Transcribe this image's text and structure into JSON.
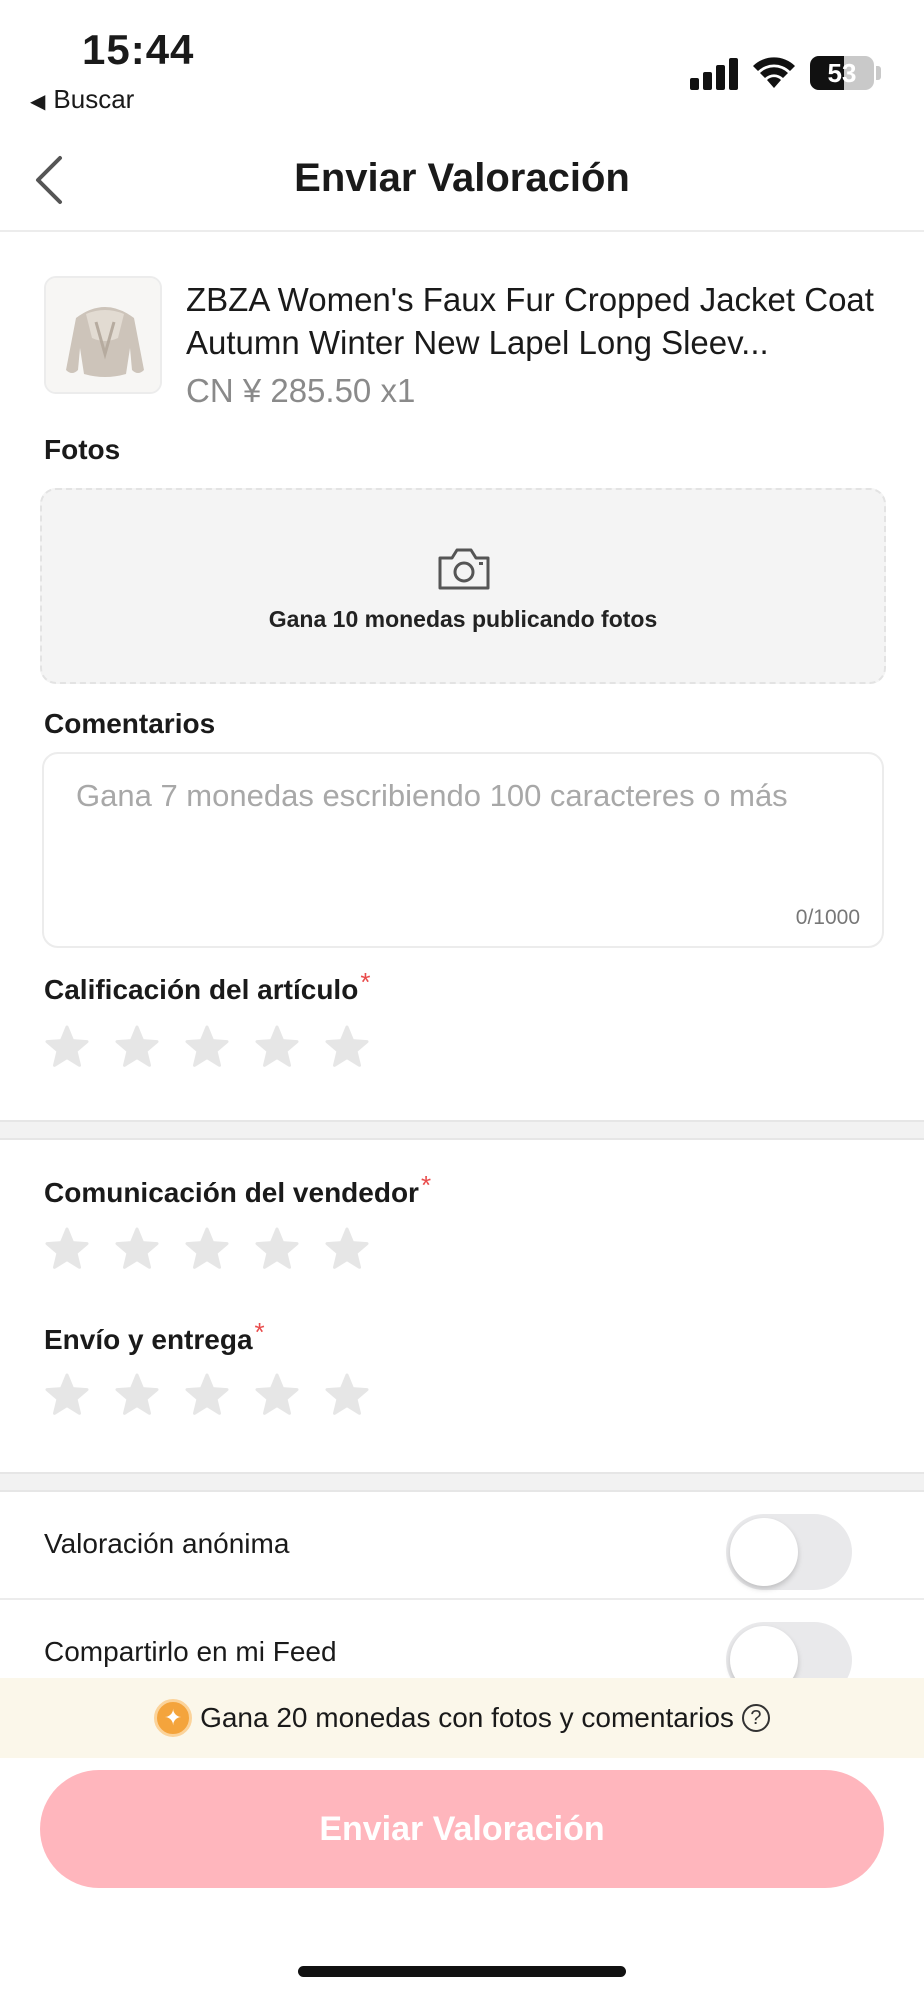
{
  "status_bar": {
    "time": "15:44",
    "back_app": "Buscar",
    "battery_level": "53",
    "battery_fraction": 0.53
  },
  "navbar": {
    "title": "Enviar Valoración"
  },
  "product": {
    "name": "ZBZA Women's Faux Fur Cropped Jacket Coat Autumn Winter New Lapel Long Sleev...",
    "price": "CN ¥  285.50 x1"
  },
  "photos": {
    "label": "Fotos",
    "hint": "Gana 10 monedas publicando fotos"
  },
  "comments": {
    "label": "Comentarios",
    "placeholder": "Gana 7 monedas escribiendo 100 caracteres o más",
    "value": "",
    "count": "0/1000"
  },
  "ratings": {
    "required_mark": "*",
    "item": {
      "label": "Calificación del artículo",
      "value": 0,
      "max": 5
    },
    "seller": {
      "label": "Comunicación del vendedor",
      "value": 0,
      "max": 5
    },
    "shipping": {
      "label": "Envío y entrega",
      "value": 0,
      "max": 5
    }
  },
  "toggles": {
    "anonymous": {
      "label": "Valoración anónima",
      "on": false
    },
    "share_feed": {
      "label": "Compartirlo en mi Feed",
      "on": false
    }
  },
  "banner": {
    "text": "Gana 20 monedas con fotos y comentarios",
    "help": "?"
  },
  "submit": {
    "label": "Enviar Valoración"
  },
  "colors": {
    "accent_disabled": "#ffb6bd",
    "required": "#e94b4b",
    "star_empty": "#e6e6e6",
    "banner_bg": "#fbf7ea",
    "coin": "#f4a43c"
  },
  "icons": {
    "back": "chevron-left-icon",
    "camera": "camera-icon",
    "star": "star-icon",
    "coin": "coin-icon",
    "help": "help-circle-icon"
  }
}
